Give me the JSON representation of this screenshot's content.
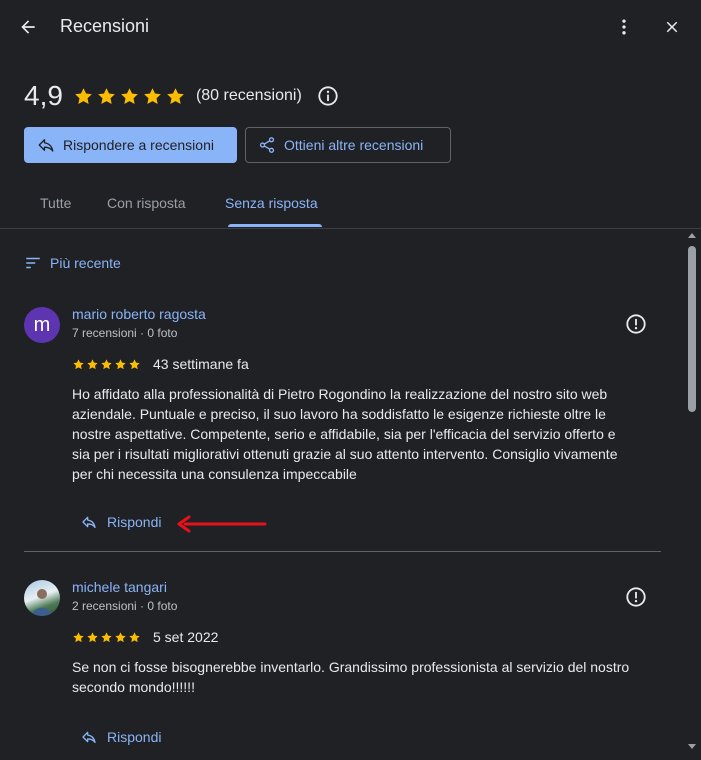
{
  "header": {
    "title": "Recensioni"
  },
  "summary": {
    "rating": "4,9",
    "stars": 5,
    "count_text": "(80 recensioni)"
  },
  "actions": {
    "reply_label": "Rispondere a recensioni",
    "get_more_label": "Ottieni altre recensioni"
  },
  "tabs": [
    {
      "label": "Tutte",
      "active": false
    },
    {
      "label": "Con risposta",
      "active": false
    },
    {
      "label": "Senza risposta",
      "active": true
    }
  ],
  "sort": {
    "label": "Più recente"
  },
  "reviews": [
    {
      "avatar_letter": "m",
      "name": "mario roberto ragosta",
      "meta": "7 recensioni · 0 foto",
      "stars": 5,
      "date": "43 settimane fa",
      "text": "Ho affidato alla professionalità di Pietro Rogondino la realizzazione del nostro sito web aziendale. Puntuale e preciso, il suo lavoro ha soddisfatto le esigenze richieste oltre le nostre aspettative. Competente, serio e affidabile, sia per l'efficacia del servizio offerto e sia per i risultati migliorativi ottenuti grazie al suo attento intervento. Consiglio vivamente per chi necessita una consulenza impeccabile",
      "reply_label": "Rispondi"
    },
    {
      "avatar_letter": "",
      "name": "michele tangari",
      "meta": "2 recensioni · 0 foto",
      "stars": 5,
      "date": "5 set 2022",
      "text": "Se non ci fosse bisognerebbe inventarlo. Grandissimo professionista al servizio del nostro secondo mondo!!!!!!",
      "reply_label": "Rispondi"
    }
  ],
  "colors": {
    "background": "#202124",
    "accent": "#8ab4f8",
    "star": "#fbbc04",
    "annotation_arrow": "#e8101a",
    "avatar_bg": "#5e35b1"
  },
  "icons": [
    "back-arrow-icon",
    "more-vert-icon",
    "close-icon",
    "star-icon",
    "info-icon",
    "reply-icon",
    "share-icon",
    "sort-icon",
    "report-icon"
  ]
}
